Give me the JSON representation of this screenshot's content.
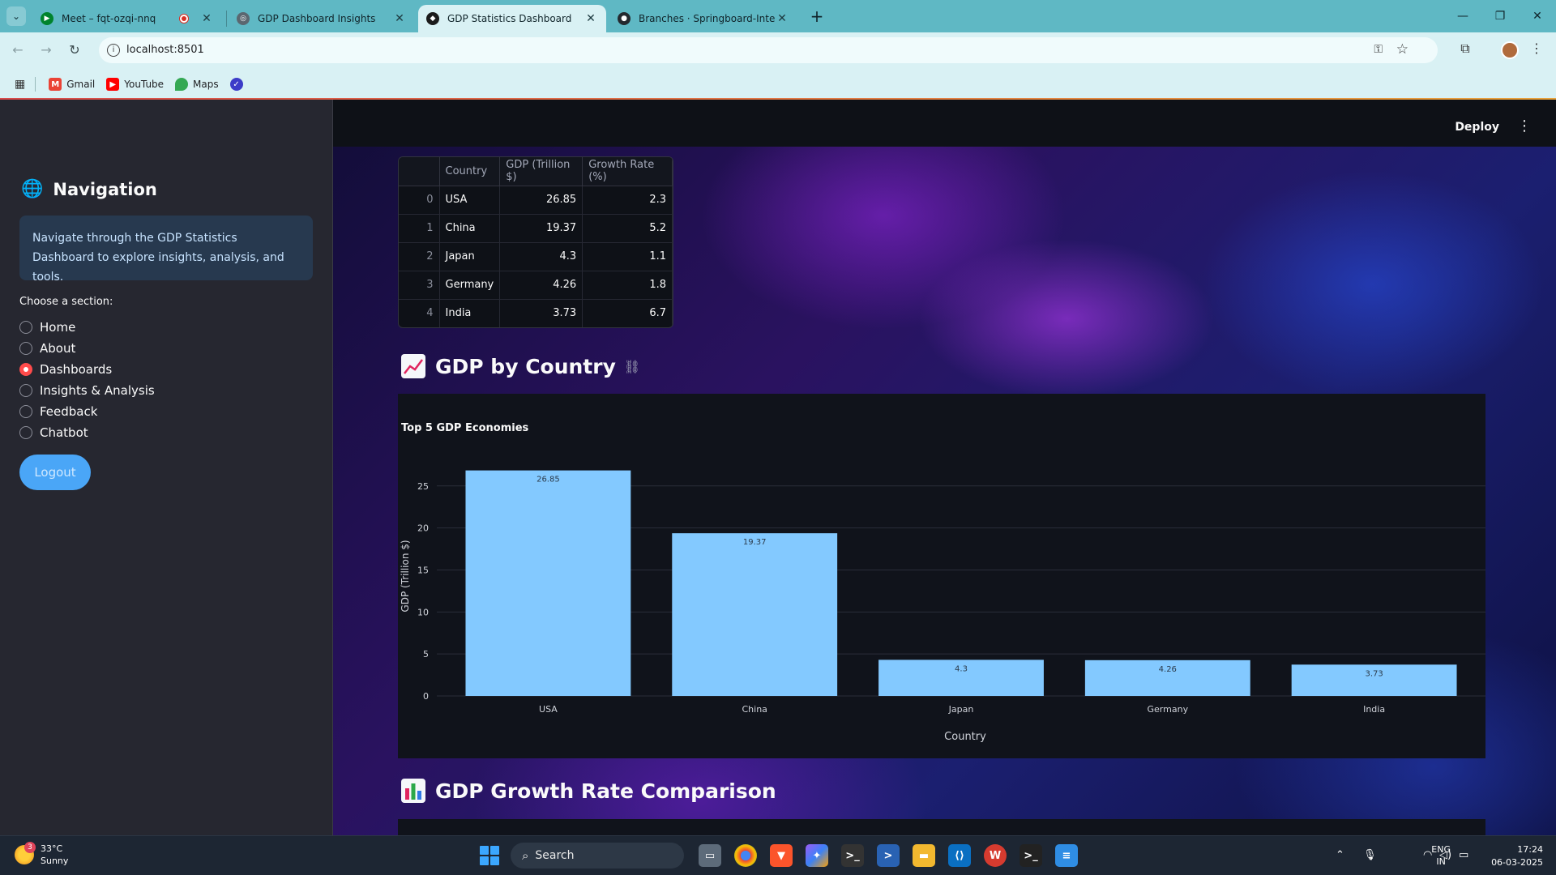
{
  "browser": {
    "tabs": [
      {
        "title": "Meet – fqt-ozqi-nnq",
        "active": false
      },
      {
        "title": "GDP Dashboard Insights",
        "active": false
      },
      {
        "title": "GDP Statistics Dashboard",
        "active": true
      },
      {
        "title": "Branches · Springboard-Internsl",
        "active": false
      }
    ],
    "url": "localhost:8501",
    "bookmarks": [
      "Gmail",
      "YouTube",
      "Maps"
    ]
  },
  "app": {
    "deploy_label": "Deploy"
  },
  "sidebar": {
    "title": "Navigation",
    "info": "Navigate through the GDP Statistics Dashboard to explore insights, analysis, and tools.",
    "choose_label": "Choose a section:",
    "options": [
      "Home",
      "About",
      "Dashboards",
      "Insights & Analysis",
      "Feedback",
      "Chatbot"
    ],
    "selected": "Dashboards",
    "logout_label": "Logout"
  },
  "table": {
    "columns": [
      "",
      "Country",
      "GDP (Trillion $)",
      "Growth Rate (%)"
    ],
    "rows": [
      [
        "0",
        "USA",
        "26.85",
        "2.3"
      ],
      [
        "1",
        "China",
        "19.37",
        "5.2"
      ],
      [
        "2",
        "Japan",
        "4.3",
        "1.1"
      ],
      [
        "3",
        "Germany",
        "4.26",
        "1.8"
      ],
      [
        "4",
        "India",
        "3.73",
        "6.7"
      ]
    ]
  },
  "sections": {
    "gdp_by_country": "GDP by Country",
    "growth_comparison": "GDP Growth Rate Comparison"
  },
  "chart_data": {
    "type": "bar",
    "title": "Top 5 GDP Economies",
    "xlabel": "Country",
    "ylabel": "GDP (Trillion $)",
    "categories": [
      "USA",
      "China",
      "Japan",
      "Germany",
      "India"
    ],
    "values": [
      26.85,
      19.37,
      4.3,
      4.26,
      3.73
    ],
    "data_labels": [
      "26.85",
      "19.37",
      "4.3",
      "4.26",
      "3.73"
    ],
    "yticks": [
      0,
      5,
      10,
      15,
      20,
      25
    ],
    "ylim": [
      0,
      28.26
    ],
    "grid": true,
    "bar_color": "#83c9ff"
  },
  "taskbar": {
    "weather_temp": "33°C",
    "weather_desc": "Sunny",
    "weather_badge": "3",
    "search_label": "Search",
    "lang_top": "ENG",
    "lang_bottom": "IN",
    "time": "17:24",
    "date": "06-03-2025"
  }
}
